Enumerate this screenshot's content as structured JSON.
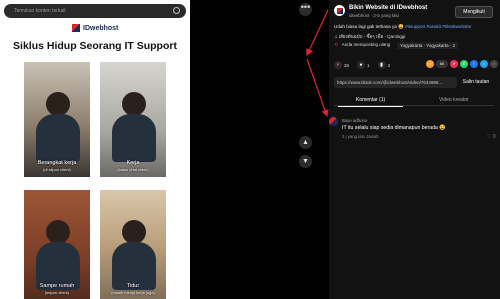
{
  "video": {
    "search_placeholder": "Temukan konten terkait",
    "brand": "IDwebhost",
    "headline": "Siklus Hidup Seorang IT Support",
    "tiles": [
      {
        "label": "Berangkat kerja",
        "sub": "(di silpon client)"
      },
      {
        "label": "Kerja",
        "sub": "(balas chat client)"
      },
      {
        "label": "Sampe rumah",
        "sub": "(telpon client)"
      },
      {
        "label": "Tidur",
        "sub": "(masih mimpi kerja juga)"
      }
    ]
  },
  "controls": {
    "more": "•••",
    "up": "▲",
    "down": "▼"
  },
  "post": {
    "account_name": "Bikin Website di IDwebhost",
    "handle_time": "idwebhost · 2-5 yang lalu",
    "follow_label": "Mengikuti",
    "caption": "Udah biasa lagi gak tethasa ya 😄",
    "hashtags": "#itsupport #asakit #tiktokwebsite",
    "music": "♫ เสียงต้นฉบับ - ซื้อๆ เพื่อ - Qarotiggi",
    "repost": "Anda memposting ulang",
    "location": "Yogyakarta · Yogyakarta · 2",
    "likes": "26",
    "comments": "1",
    "saves": "3",
    "share_count": "60",
    "url": "https://www.tiktok.com/@idwebhost/video/7634988...",
    "copy_label": "Salin tautan"
  },
  "tabs": {
    "comments": "Komentar (1)",
    "creator": "Video kreator"
  },
  "comment": {
    "author": "Bayu adhono",
    "text": "IT itu selalu siap sedia dimanapun berada 😄",
    "meta": "3 j yang lalu    Jawab",
    "likes": "0"
  },
  "colors": {
    "accent": "#e0444e",
    "hashtag": "#69a7ff",
    "brand_red": "#d02b2b",
    "brand_navy": "#1d2a5b"
  }
}
